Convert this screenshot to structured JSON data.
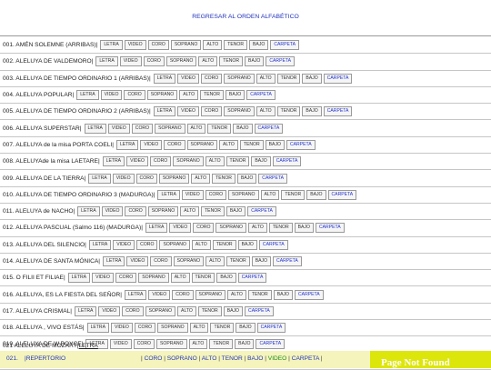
{
  "header": {
    "back_link": "REGRESAR AL ORDEN ALFABÉTICO"
  },
  "buttons": [
    "LETRA",
    "VIDEO",
    "CORO",
    "SOPRANO",
    "ALTO",
    "TENOR",
    "BAJO",
    "CARPETA"
  ],
  "rows": [
    {
      "title": "001. AMÉN SOLEMNE (ARRIBAS)|",
      "buttons": [
        "LETRA",
        "VIDEO",
        "CORO",
        "SOPRANO",
        "ALTO",
        "TENOR",
        "BAJO",
        "CARPETA"
      ]
    },
    {
      "title": "002. ALELUYA DE VALDEMORO|",
      "buttons": [
        "LETRA",
        "VIDEO",
        "CORO",
        "SOPRANO",
        "ALTO",
        "TENOR",
        "BAJO",
        "CARPETA"
      ]
    },
    {
      "title": "003. ALELUYA DE TIEMPO ORDINARIO 1 (ARRIBAS)|",
      "buttons": [
        "LETRA",
        "VIDEO",
        "CORO",
        "SOPRANO",
        "ALTO",
        "TENOR",
        "BAJO",
        "CARPETA"
      ]
    },
    {
      "title": "004. ALELUYA POPULAR|",
      "buttons": [
        "LETRA",
        "VIDEO",
        "CORO",
        "SOPRANO",
        "ALTO",
        "TENOR",
        "BAJO",
        "CARPETA"
      ]
    },
    {
      "title": "005. ALELUYA DE TIEMPO ORDINARIO 2 (ARRIBAS)|",
      "buttons": [
        "LETRA",
        "VIDEO",
        "CORO",
        "SOPRANO",
        "ALTO",
        "TENOR",
        "BAJO",
        "CARPETA"
      ]
    },
    {
      "title": "006. ALELUYA SUPERSTAR|",
      "buttons": [
        "LETRA",
        "VIDEO",
        "CORO",
        "SOPRANO",
        "ALTO",
        "TENOR",
        "BAJO",
        "CARPETA"
      ]
    },
    {
      "title": "007. ALELUYA de la misa PORTA COELI|",
      "buttons": [
        "LETRA",
        "VIDEO",
        "CORO",
        "SOPRANO",
        "ALTO",
        "TENOR",
        "BAJO",
        "CARPETA"
      ]
    },
    {
      "title": "008. ALELUYAde la misa LAETARE|",
      "buttons": [
        "LETRA",
        "VIDEO",
        "CORO",
        "SOPRANO",
        "ALTO",
        "TENOR",
        "BAJO",
        "CARPETA"
      ]
    },
    {
      "title": "009. ALELUYA DE LA TIERRA|",
      "buttons": [
        "LETRA",
        "VIDEO",
        "CORO",
        "SOPRANO",
        "ALTO",
        "TENOR",
        "BAJO",
        "CARPETA"
      ]
    },
    {
      "title": "010. ALELUYA DE TIEMPO ORDINARIO 3 (MADURGA)|",
      "buttons": [
        "LETRA",
        "VIDEO",
        "CORO",
        "SOPRANO",
        "ALTO",
        "TENOR",
        "BAJO",
        "CARPETA"
      ]
    },
    {
      "title": "011. ALELUYA de NACHO|",
      "buttons": [
        "LETRA",
        "VIDEO",
        "CORO",
        "SOPRANO",
        "ALTO",
        "TENOR",
        "BAJO",
        "CARPETA"
      ]
    },
    {
      "title": "012. ALELUYA PASCUAL (Salmo 116) (MADURGA)|",
      "buttons": [
        "LETRA",
        "VIDEO",
        "CORO",
        "SOPRANO",
        "ALTO",
        "TENOR",
        "BAJO",
        "CARPETA"
      ]
    },
    {
      "title": "013. ALELUYA DEL SILENCIO|",
      "buttons": [
        "LETRA",
        "VIDEO",
        "CORO",
        "SOPRANO",
        "ALTO",
        "TENOR",
        "BAJO",
        "CARPETA"
      ]
    },
    {
      "title": "014. ALELUYA DE SANTA MÓNICA|",
      "buttons": [
        "LETRA",
        "VIDEO",
        "CORO",
        "SOPRANO",
        "ALTO",
        "TENOR",
        "BAJO",
        "CARPETA"
      ]
    },
    {
      "title": "015. O FILII ET FILIAE|",
      "buttons": [
        "LETRA",
        "VIDEO",
        "CORO",
        "SOPRANO",
        "ALTO",
        "TENOR",
        "BAJO",
        "CARPETA"
      ]
    },
    {
      "title": "016. ALELUYA, ES LA FIESTA DEL SEÑOR|",
      "buttons": [
        "LETRA",
        "VIDEO",
        "CORO",
        "SOPRANO",
        "ALTO",
        "TENOR",
        "BAJO",
        "CARPETA"
      ]
    },
    {
      "title": "017. ALELUYA CRISMAL|",
      "buttons": [
        "LETRA",
        "VIDEO",
        "CORO",
        "SOPRANO",
        "ALTO",
        "TENOR",
        "BAJO",
        "CARPETA"
      ]
    },
    {
      "title": "018. ALELUYA , VIVO ESTÁS|",
      "buttons": [
        "LETRA",
        "VIDEO",
        "CORO",
        "SOPRANO",
        "ALTO",
        "TENOR",
        "BAJO",
        "CARPETA"
      ]
    },
    {
      "title": "019. ALELUYA DE W.BOYCE|",
      "buttons": [
        "LETRA",
        "VIDEO",
        "CORO",
        "SOPRANO",
        "ALTO",
        "TENOR",
        "BAJO",
        "CARPETA"
      ]
    },
    {
      "title": "020. ALELUIA DE GABRIELLI|",
      "buttons": [
        "LETRA",
        "VIDEO",
        "CORO",
        "SOPRANO",
        "ALTO",
        "TENOR",
        "BAJO",
        "CARPETA"
      ]
    }
  ],
  "last_row": {
    "title": "021 ALELUYA DE MOZART|",
    "link": "LETRA"
  },
  "footer": {
    "number": "021.",
    "repertorio": "|REPERTORIO",
    "links_prefix": "|",
    "links": [
      "CORO",
      "SOPRANO",
      "ALTO",
      "TENOR",
      "BAJO",
      "VIDEO",
      "CARPETA"
    ],
    "links_suffix": "|"
  },
  "overlay": {
    "text": "Page Not Found"
  },
  "colors": {
    "link": "#2233bb",
    "footer_bg": "#f4f4bc",
    "overlay_bg": "#dde60a",
    "video_link": "#1a8a1a"
  }
}
